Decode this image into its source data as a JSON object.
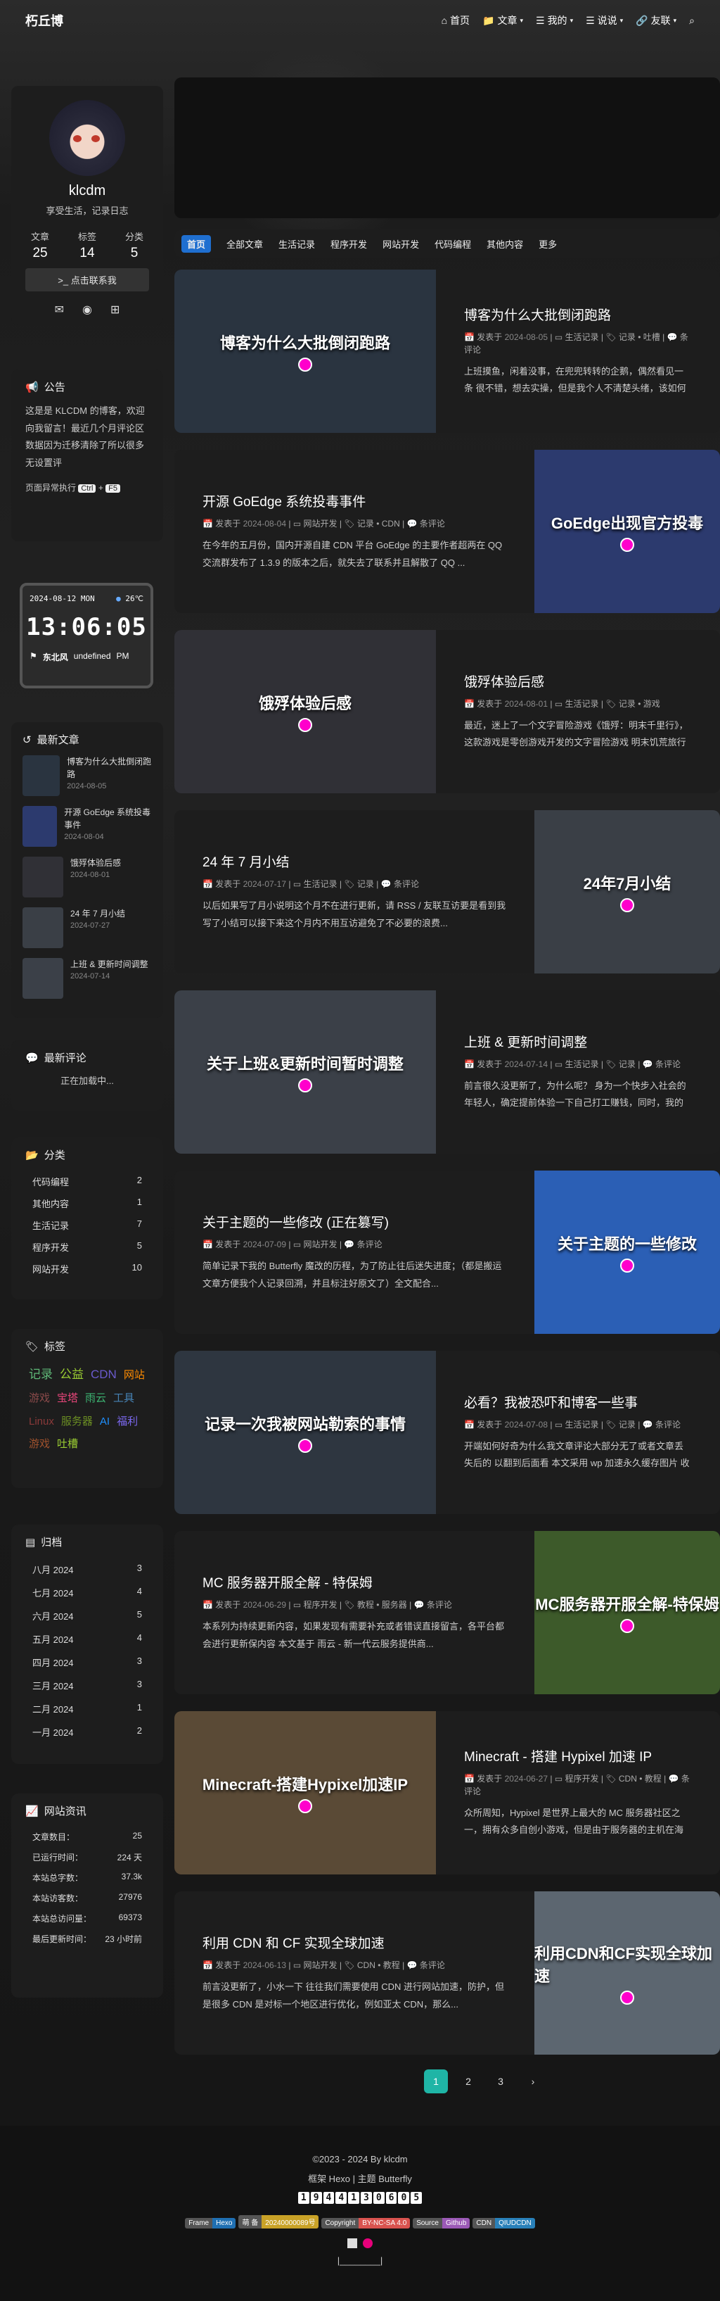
{
  "nav": {
    "logo": "朽丘博",
    "items": [
      "首页",
      "文章",
      "我的",
      "说说",
      "友联"
    ]
  },
  "profile": {
    "name": "klcdm",
    "motto": "享受生活，记录日志",
    "stats": [
      {
        "label": "文章",
        "value": "25"
      },
      {
        "label": "标签",
        "value": "14"
      },
      {
        "label": "分类",
        "value": "5"
      }
    ],
    "contact": ">_ 点击联系我"
  },
  "announce": {
    "title": "公告",
    "text": "这是是 KLCDM 的博客，欢迎向我留言！最近几个月评论区数据因为迁移清除了所以很多无设置评",
    "exception": "页面异常执行",
    "key1": "Ctrl",
    "plus": "+",
    "key2": "F5"
  },
  "clock": {
    "date": "2024-08-12 MON",
    "temp": "26℃",
    "time": "13:06:05",
    "wind": "东北风",
    "extra": "undefined",
    "ampm": "PM"
  },
  "recent": {
    "title": "最新文章",
    "items": [
      {
        "t": "博客为什么大批倒闭跑路",
        "d": "2024-08-05"
      },
      {
        "t": "开源 GoEdge 系统投毒事件",
        "d": "2024-08-04"
      },
      {
        "t": "饿殍体验后感",
        "d": "2024-08-01"
      },
      {
        "t": "24 年 7 月小结",
        "d": "2024-07-27"
      },
      {
        "t": "上班 & 更新时间调整",
        "d": "2024-07-14"
      }
    ]
  },
  "comments": {
    "title": "最新评论",
    "loading": "正在加载中..."
  },
  "categories": {
    "title": "分类",
    "items": [
      {
        "n": "代码编程",
        "c": "2"
      },
      {
        "n": "其他内容",
        "c": "1"
      },
      {
        "n": "生活记录",
        "c": "7"
      },
      {
        "n": "程序开发",
        "c": "5"
      },
      {
        "n": "网站开发",
        "c": "10"
      }
    ]
  },
  "tags": {
    "title": "标签",
    "items": [
      {
        "n": "记录",
        "c": "#5fb878"
      },
      {
        "n": "公益",
        "c": "#9acd32"
      },
      {
        "n": "CDN",
        "c": "#6a5acd"
      },
      {
        "n": "网站",
        "c": "#ff8c00"
      },
      {
        "n": "游戏",
        "c": "#8b4a4a"
      },
      {
        "n": "宝塔",
        "c": "#e9467b"
      },
      {
        "n": "雨云",
        "c": "#3cb371"
      },
      {
        "n": "工具",
        "c": "#4682b4"
      },
      {
        "n": "Linux",
        "c": "#8b3a3a"
      },
      {
        "n": "服务器",
        "c": "#6b8e23"
      },
      {
        "n": "AI",
        "c": "#1e90ff"
      },
      {
        "n": "福利",
        "c": "#7b68ee"
      },
      {
        "n": "游戏",
        "c": "#a0522d"
      },
      {
        "n": "吐槽",
        "c": "#9acd32"
      }
    ]
  },
  "archives": {
    "title": "归档",
    "items": [
      {
        "m": "八月 2024",
        "c": "3"
      },
      {
        "m": "七月 2024",
        "c": "4"
      },
      {
        "m": "六月 2024",
        "c": "5"
      },
      {
        "m": "五月 2024",
        "c": "4"
      },
      {
        "m": "四月 2024",
        "c": "3"
      },
      {
        "m": "三月 2024",
        "c": "3"
      },
      {
        "m": "二月 2024",
        "c": "1"
      },
      {
        "m": "一月 2024",
        "c": "2"
      }
    ]
  },
  "siteinfo": {
    "title": "网站资讯",
    "items": [
      {
        "k": "文章数目：",
        "v": "25"
      },
      {
        "k": "已运行时间：",
        "v": "224 天"
      },
      {
        "k": "本站总字数：",
        "v": "37.3k"
      },
      {
        "k": "本站访客数：",
        "v": "27976"
      },
      {
        "k": "本站总访问量：",
        "v": "69373"
      },
      {
        "k": "最后更新时间：",
        "v": "23 小时前"
      }
    ]
  },
  "tabs": [
    "首页",
    "全部文章",
    "生活记录",
    "程序开发",
    "网站开发",
    "代码编程",
    "其他内容",
    "更多"
  ],
  "posts": [
    {
      "title": "博客为什么大批倒闭跑路",
      "date": "2024-08-05",
      "cat": "生活记录",
      "tags": "记录 • 吐槽",
      "comments": "条评论",
      "excerpt": "上班摸鱼，闲着没事，在兜兜转转的企鹅，偶然看见一条 很不错，想去实操，但是我个人不清楚头绪，该如何去做。",
      "thumb": "博客为什么大批倒闭跑路",
      "color": "#2a3440"
    },
    {
      "title": "开源 GoEdge 系统投毒事件",
      "date": "2024-08-04",
      "cat": "网站开发",
      "tags": "记录 • CDN",
      "comments": "条评论",
      "excerpt": "在今年的五月份，国内开源自建 CDN 平台 GoEdge 的主要作者超两在 QQ 交流群发布了 1.3.9 的版本之后，就失去了联系并且解散了 QQ ...",
      "thumb": "GoEdge出现官方投毒",
      "color": "#2c3a6e"
    },
    {
      "title": "饿殍体验后感",
      "date": "2024-08-01",
      "cat": "生活记录",
      "tags": "记录 • 游戏",
      "comments": "",
      "excerpt": "最近，迷上了一个文字冒险游戏《饿殍：明末千里行》，这款游戏是零创游戏开发的文字冒险游戏 明末饥荒旅行游戏《饿殍：明...",
      "thumb": "饿殍体验后感",
      "color": "#303036"
    },
    {
      "title": "24 年 7 月小结",
      "date": "2024-07-17",
      "cat": "生活记录",
      "tags": "记录",
      "comments": "条评论",
      "excerpt": "以后如果写了月小说明这个月不在进行更新，请 RSS / 友联互访要是看到我写了小结可以接下来这个月内不用互访避免了不必要的浪费...",
      "thumb": "24年7月小结",
      "color": "#3a3f46"
    },
    {
      "title": "上班 & 更新时间调整",
      "date": "2024-07-14",
      "cat": "生活记录",
      "tags": "记录",
      "comments": "条评论",
      "excerpt": "前言很久没更新了，为什么呢？ 身为一个快步入社会的年轻人，确定提前体验一下自己打工赚钱，同时，我的众多公益项目...",
      "thumb": "关于上班&更新时间暂时调整",
      "color": "#3b4048"
    },
    {
      "title": "关于主题的一些修改 (正在篡写)",
      "date": "2024-07-09",
      "cat": "网站开发",
      "tags": "",
      "comments": "条评论",
      "excerpt": "简单记录下我的 Butterfly 魔改的历程，为了防止往后迷失进度；（都是搬运文章方便我个人记录回溯，并且标注好原文了）全文配合...",
      "thumb": "关于主题的一些修改",
      "color": "#2b5fb5"
    },
    {
      "title": "必看？我被恐吓和博客一些事",
      "date": "2024-07-08",
      "cat": "生活记录",
      "tags": "记录",
      "comments": "条评论",
      "excerpt": "开端如何好奇为什么我文章评论大部分无了或者文章丢失后的 以翻到后面看 本文采用 wp 加速永久缓存图片 收到邮件在一...",
      "thumb": "记录一次我被网站勒索的事情",
      "color": "#2e3640"
    },
    {
      "title": "MC 服务器开服全解 - 特保姆",
      "date": "2024-06-29",
      "cat": "程序开发",
      "tags": "教程 • 服务器",
      "comments": "条评论",
      "excerpt": "本系列为持续更新内容，如果发现有需要补充或者错误直接留言，各平台都会进行更新保内容 本文基于 雨云 - 新一代云服务提供商...",
      "thumb": "MC服务器开服全解-特保姆",
      "color": "#3d5a2a"
    },
    {
      "title": "Minecraft - 搭建 Hypixel 加速 IP",
      "date": "2024-06-27",
      "cat": "程序开发",
      "tags": "CDN • 教程",
      "comments": "条评论",
      "excerpt": "众所周知，Hypixel 是世界上最大的 MC 服务器社区之一，拥有众多自创小游戏，但是由于服务器的主机在海外，导致大陆镜连...",
      "thumb": "Minecraft-搭建Hypixel加速IP",
      "color": "#5a4a36"
    },
    {
      "title": "利用 CDN 和 CF 实现全球加速",
      "date": "2024-06-13",
      "cat": "网站开发",
      "tags": "CDN • 教程",
      "comments": "条评论",
      "excerpt": "前言没更新了，小水一下 往往我们需要使用 CDN 进行网站加速，防护，但是很多 CDN 是对标一个地区进行优化，例如亚太 CDN，那么...",
      "thumb": "利用CDN和CF实现全球加速",
      "color": "#5c6670"
    }
  ],
  "pager": [
    "1",
    "2",
    "3",
    "›"
  ],
  "footer": {
    "copy": "©2023 - 2024 By klcdm",
    "frame": "框架 Hexo | 主题 Butterfly",
    "digits": [
      "1",
      "9",
      "4",
      "4",
      "1",
      "3",
      "0",
      "6",
      "0",
      "5"
    ],
    "badges": [
      {
        "a": "Frame",
        "b": "Hexo",
        "c": "#1f6fb2"
      },
      {
        "a": "萌 备",
        "b": "20240000089号",
        "c": "#c9a227"
      },
      {
        "a": "Copyright",
        "b": "BY-NC-SA 4.0",
        "c": "#d9534f"
      },
      {
        "a": "Source",
        "b": "Github",
        "c": "#9b59b6"
      },
      {
        "a": "CDN",
        "b": "QIUDCDN",
        "c": "#2980b9"
      }
    ],
    "bottom": "|________|"
  }
}
